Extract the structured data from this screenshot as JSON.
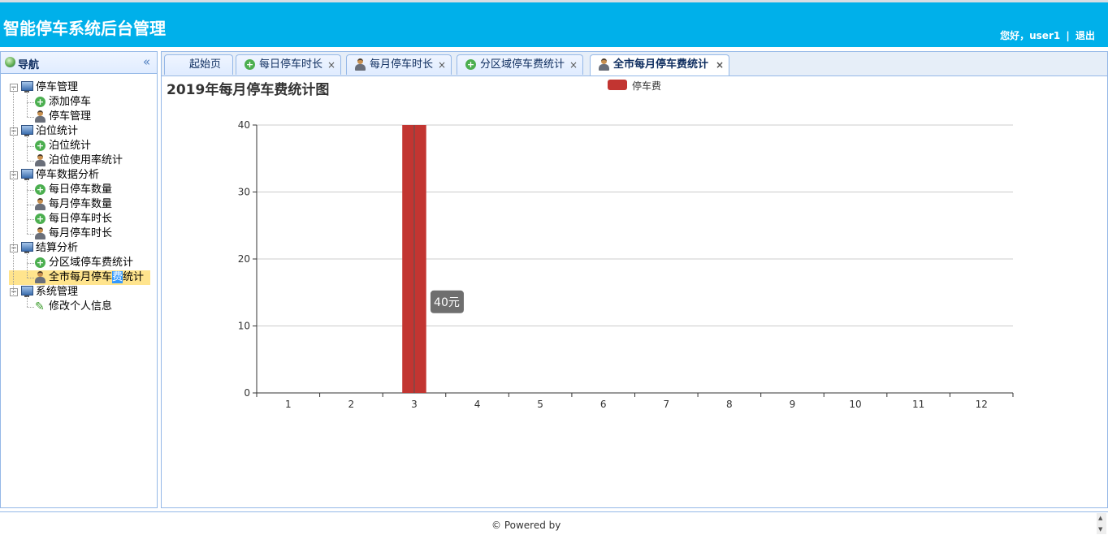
{
  "app": {
    "title": "智能停车系统后台管理",
    "greeting": "您好，user1",
    "separator": "|",
    "logout": "退出"
  },
  "nav": {
    "title": "导航",
    "collapse_glyph": "«",
    "tree": [
      {
        "label": "停车管理",
        "icon": "computer-icon",
        "children": [
          {
            "label": "添加停车",
            "icon": "add-icon"
          },
          {
            "label": "停车管理",
            "icon": "user-icon"
          }
        ]
      },
      {
        "label": "泊位统计",
        "icon": "computer-icon",
        "children": [
          {
            "label": "泊位统计",
            "icon": "add-icon"
          },
          {
            "label": "泊位使用率统计",
            "icon": "user-icon"
          }
        ]
      },
      {
        "label": "停车数据分析",
        "icon": "computer-icon",
        "children": [
          {
            "label": "每日停车数量",
            "icon": "add-icon"
          },
          {
            "label": "每月停车数量",
            "icon": "user-icon"
          },
          {
            "label": "每日停车时长",
            "icon": "add-icon"
          },
          {
            "label": "每月停车时长",
            "icon": "user-icon"
          }
        ]
      },
      {
        "label": "结算分析",
        "icon": "computer-icon",
        "children": [
          {
            "label": "分区域停车费统计",
            "icon": "add-icon"
          },
          {
            "label": "全市每月停车费统计",
            "icon": "user-icon",
            "selected": true,
            "label_pre": "全市每月停车",
            "label_mark": "费",
            "label_post": "统计"
          }
        ]
      },
      {
        "label": "系统管理",
        "icon": "computer-icon",
        "children": [
          {
            "label": "修改个人信息",
            "icon": "pencil-icon"
          }
        ]
      }
    ]
  },
  "tabs": [
    {
      "label": "起始页",
      "icon": "",
      "closable": false,
      "active": false
    },
    {
      "label": "每日停车时长",
      "icon": "add-icon",
      "closable": true,
      "active": false
    },
    {
      "label": "每月停车时长",
      "icon": "user-icon",
      "closable": true,
      "active": false
    },
    {
      "label": "分区域停车费统计",
      "icon": "add-icon",
      "closable": true,
      "active": false
    },
    {
      "label": "全市每月停车费统计",
      "icon": "user-icon",
      "closable": true,
      "active": true
    }
  ],
  "tab_close_glyph": "×",
  "chart_data": {
    "type": "bar",
    "title": "2019年每月停车费统计图",
    "categories": [
      "1",
      "2",
      "3",
      "4",
      "5",
      "6",
      "7",
      "8",
      "9",
      "10",
      "11",
      "12"
    ],
    "series": [
      {
        "name": "停车费",
        "values": [
          0,
          0,
          40,
          0,
          0,
          0,
          0,
          0,
          0,
          0,
          0,
          0
        ],
        "color": "#c23531"
      }
    ],
    "ylim": [
      0,
      40
    ],
    "yticks": [
      0,
      10,
      20,
      30,
      40
    ],
    "grid": true,
    "legend": "top-center",
    "tooltip": {
      "category": "3",
      "text": "40元"
    }
  },
  "footer": {
    "text": "© Powered by"
  }
}
